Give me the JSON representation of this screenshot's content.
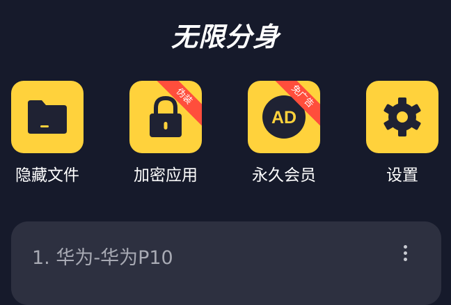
{
  "header": {
    "title": "无限分身"
  },
  "tiles": [
    {
      "label": "隐藏文件",
      "icon": "folder-icon",
      "badge": ""
    },
    {
      "label": "加密应用",
      "icon": "lock-icon",
      "badge": "伪装"
    },
    {
      "label": "永久会员",
      "icon": "ad-icon",
      "badge": "免广告",
      "icon_text": "AD"
    },
    {
      "label": "设置",
      "icon": "gear-icon",
      "badge": ""
    }
  ],
  "clone_list": [
    {
      "title": "1. 华为-华为P10",
      "menu_icon": "more-vertical-icon"
    }
  ],
  "colors": {
    "background": "#161a2b",
    "tile": "#ffd23c",
    "icon_dark": "#1f2233",
    "badge": "#ff4e3c",
    "card": "#2d3040"
  }
}
